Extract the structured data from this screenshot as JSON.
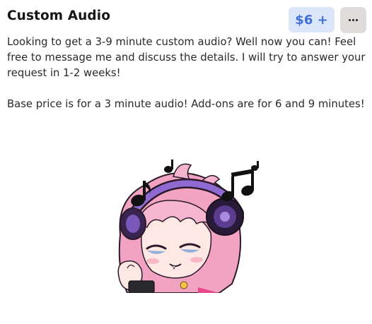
{
  "product": {
    "title": "Custom Audio",
    "price_label": "$6 +",
    "description_1": "Looking to get a 3-9 minute custom audio? Well now you can! Feel free to message me and discuss the details. I will try to answer your request in 1-2 weeks!",
    "description_2": "Base price is for a 3 minute audio! Add-ons are for 6 and 9 minutes!"
  },
  "colors": {
    "price_bg": "#dce6fb",
    "price_text": "#3c6fd8",
    "more_bg": "#e1dcdc",
    "hair_pink": "#f2a3c2",
    "headphone_purple": "#5b3c8f"
  },
  "icons": {
    "more": "ellipsis-icon",
    "notes": "music-note-icon"
  }
}
